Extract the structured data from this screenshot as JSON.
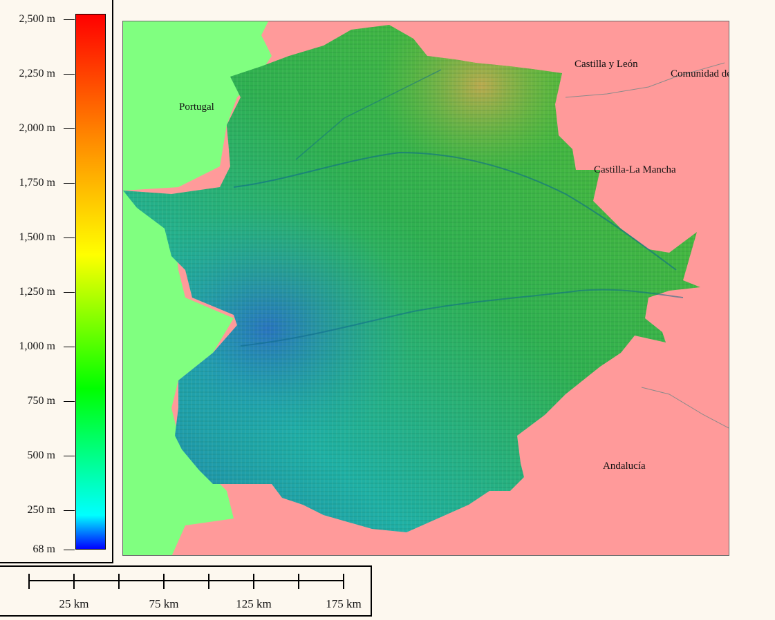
{
  "legend": {
    "title": "",
    "ticks": [
      {
        "label": "2,500 m",
        "value": 2500
      },
      {
        "label": "2,250 m",
        "value": 2250
      },
      {
        "label": "2,000 m",
        "value": 2000
      },
      {
        "label": "1,750 m",
        "value": 1750
      },
      {
        "label": "1,500 m",
        "value": 1500
      },
      {
        "label": "1,250 m",
        "value": 1250
      },
      {
        "label": "1,000 m",
        "value": 1000
      },
      {
        "label": "750 m",
        "value": 750
      },
      {
        "label": "500 m",
        "value": 500
      },
      {
        "label": "250 m",
        "value": 250
      },
      {
        "label": "68 m",
        "value": 68
      }
    ],
    "min": 68,
    "max": 2500,
    "colors": [
      "#0000ff",
      "#00ffff",
      "#00ff00",
      "#ffff00",
      "#ff8800",
      "#ff0000"
    ]
  },
  "map": {
    "colors": {
      "portugal": "#80ff80",
      "spain_other": "#ff9a9a",
      "terrain_low": "#1aa3a3",
      "terrain_mid": "#2fb35a",
      "terrain_high": "#8fbf30"
    },
    "labels": {
      "portugal": "Portugal",
      "castilla_leon": "Castilla y León",
      "madrid": "Comunidad de Madrid",
      "castilla_la_mancha": "Castilla-La Mancha",
      "andalucia": "Andalucía"
    }
  },
  "scale_bar": {
    "labels": [
      "25 km",
      "75 km",
      "125 km",
      "175 km"
    ],
    "ticks_km": [
      0,
      25,
      50,
      75,
      100,
      125,
      150,
      175
    ]
  }
}
